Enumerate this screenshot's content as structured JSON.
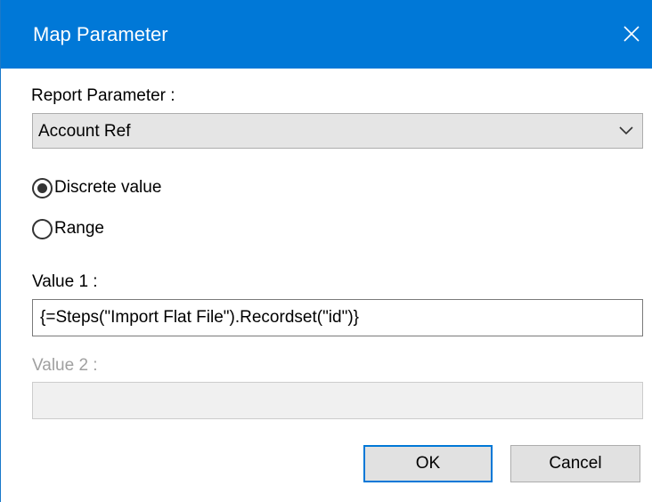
{
  "window": {
    "title": "Map Parameter",
    "accent_color": "#0078d7"
  },
  "report_parameter": {
    "label": "Report Parameter :",
    "selected": "Account Ref"
  },
  "radios": {
    "discrete_label": "Discrete value",
    "range_label": "Range",
    "selected": "Discrete value"
  },
  "value1": {
    "label": "Value 1 :",
    "value": "{=Steps(\"Import Flat File\").Recordset(\"id\")}"
  },
  "value2": {
    "label": "Value 2 :",
    "value": ""
  },
  "buttons": {
    "ok_label": "OK",
    "cancel_label": "Cancel"
  },
  "icons": {
    "close": "close-icon",
    "dropdown": "chevron-down-icon"
  }
}
